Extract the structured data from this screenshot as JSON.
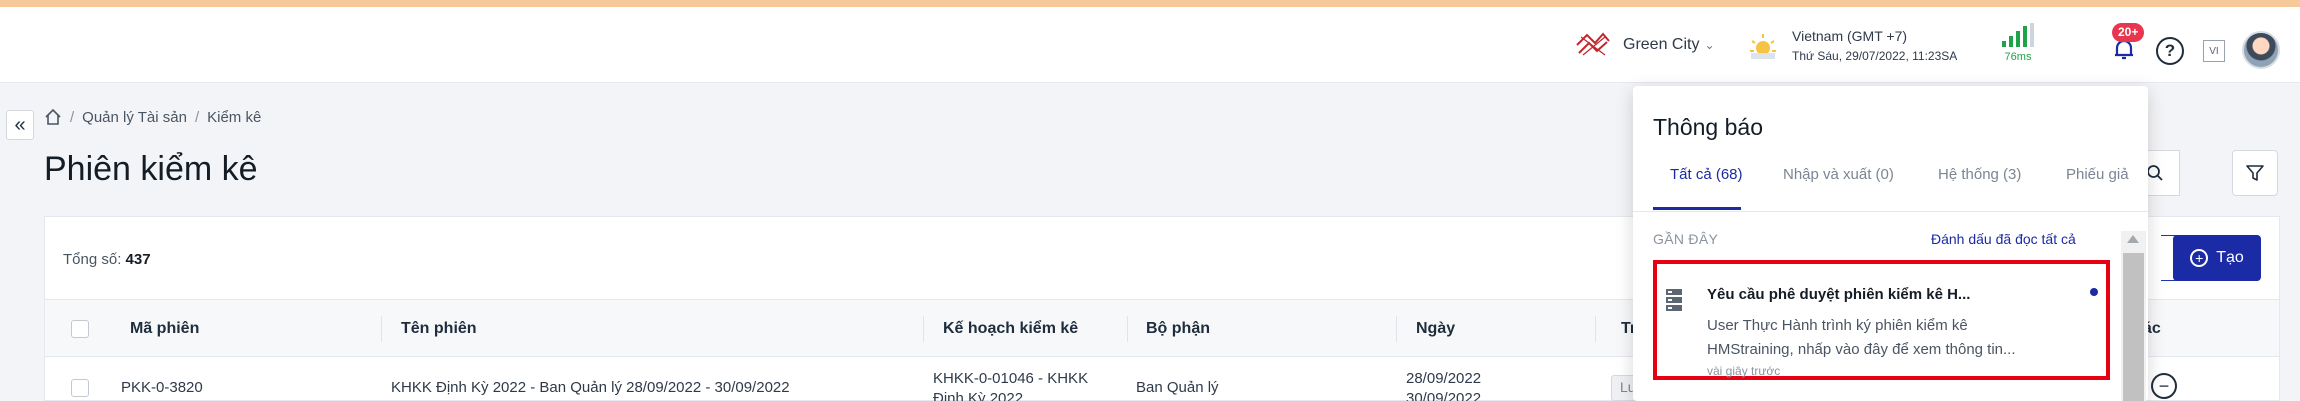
{
  "topbar": {
    "project_name": "Green City",
    "timezone": "Vietnam (GMT +7)",
    "datetime": "Thứ Sáu, 29/07/2022, 11:23SA",
    "latency": "76ms",
    "notification_count": "20+",
    "lang": "VI",
    "signal_color": "#1ea34a",
    "badge_color": "#e8364f"
  },
  "breadcrumb": {
    "items": [
      "Quản lý Tài sản",
      "Kiểm kê"
    ]
  },
  "page": {
    "title": "Phiên kiểm kê"
  },
  "summary": {
    "total_label": "Tổng số:",
    "total_value": "437"
  },
  "actions": {
    "create_label": "Tạo",
    "accent": "#1b2aa5"
  },
  "table": {
    "columns": [
      "Mã phiên",
      "Tên phiên",
      "Kế hoạch kiểm kê",
      "Bộ phận",
      "Ngày",
      "Tr",
      "ác"
    ],
    "rows": [
      {
        "code": "PKK-0-3820",
        "name": "KHKK Định Kỳ 2022 - Ban Quản lý 28/09/2022 - 30/09/2022",
        "plan": "KHKK-0-01046 - KHKK",
        "plan_line2": "Định Kỳ 2022",
        "department": "Ban Quản lý",
        "date": "28/09/2022",
        "date_line2": "30/09/2022",
        "status": "Lư"
      }
    ]
  },
  "notifications": {
    "title": "Thông báo",
    "tabs": [
      "Tất cả (68)",
      "Nhập và xuất (0)",
      "Hệ thống (3)",
      "Phiếu giả"
    ],
    "recent_label": "GẦN ĐÂY",
    "mark_all_label": "Đánh dấu đã đọc tất cả",
    "items": [
      {
        "title": "Yêu cầu phê duyệt phiên kiểm kê H...",
        "body": "User Thực Hành trình ký phiên kiểm kê HMStraining, nhấp vào đây để xem thông tin...",
        "time": "vài giây trước"
      }
    ]
  }
}
